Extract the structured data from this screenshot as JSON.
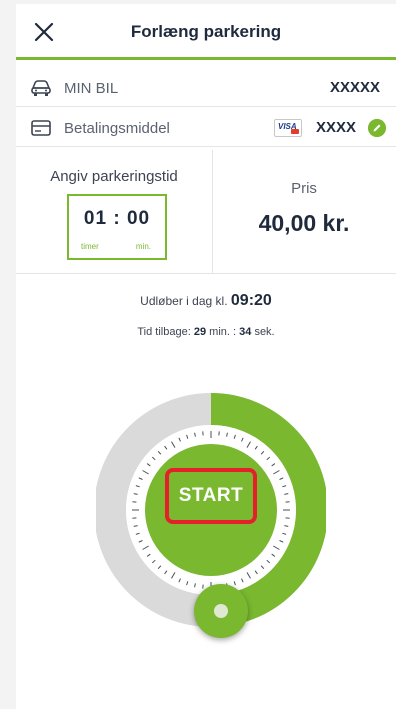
{
  "header": {
    "title": "Forlæng parkering",
    "close_icon": "close-icon"
  },
  "car": {
    "icon": "car-icon",
    "label": "MIN BIL",
    "value": "XXXXX"
  },
  "payment": {
    "icon": "card-icon",
    "label": "Betalingsmiddel",
    "card_brand": "VISA",
    "value": "XXXX",
    "edit_icon": "pencil-icon"
  },
  "duration": {
    "label": "Angiv parkeringstid",
    "value": "01 : 00",
    "unit_hours": "timer",
    "unit_minutes": "min."
  },
  "price": {
    "label": "Pris",
    "value": "40,00 kr."
  },
  "expiry": {
    "prefix": "Udløber i dag kl.",
    "time": "09:20"
  },
  "remaining": {
    "prefix": "Tid tilbage:",
    "minutes": "29",
    "minutes_unit": "min. :",
    "seconds": "34",
    "seconds_unit": "sek."
  },
  "dial": {
    "start_label": "START",
    "progress_fraction": 0.5
  },
  "colors": {
    "accent": "#79b82f",
    "track": "#dadada",
    "text_dark": "#1f2a3d",
    "highlight": "#e5202a"
  }
}
